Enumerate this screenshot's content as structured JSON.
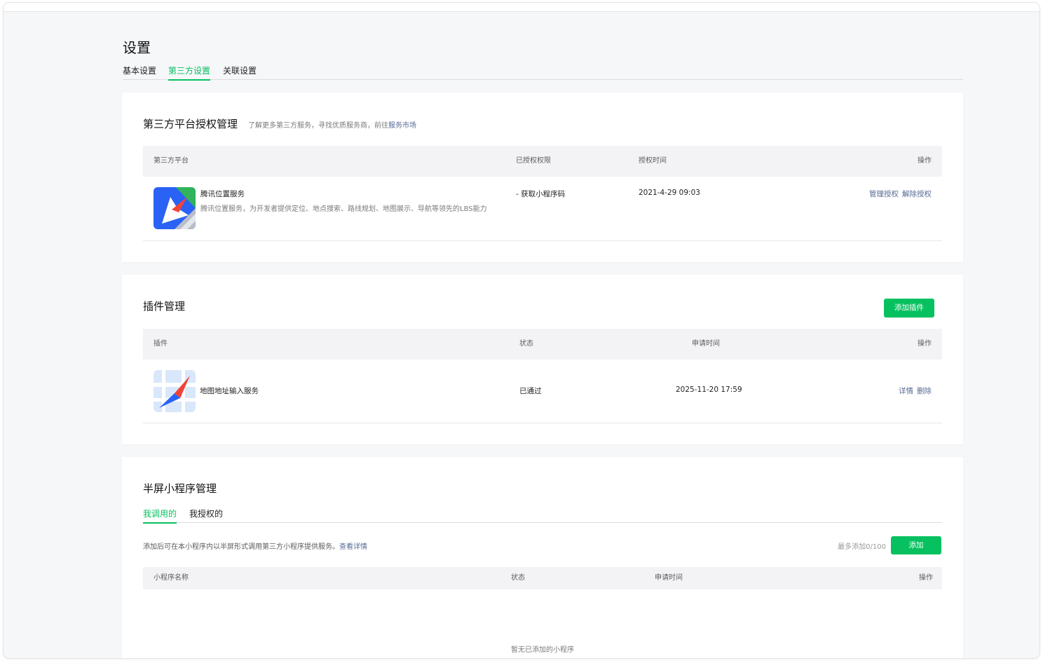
{
  "page": {
    "title": "设置"
  },
  "tabs": [
    {
      "label": "基本设置",
      "active": false
    },
    {
      "label": "第三方设置",
      "active": true
    },
    {
      "label": "关联设置",
      "active": false
    }
  ],
  "third_party": {
    "title": "第三方平台授权管理",
    "desc_prefix": "了解更多第三方服务，寻找优质服务商，前往",
    "desc_link": "服务市场",
    "columns": [
      "第三方平台",
      "已授权权限",
      "授权时间",
      "操作"
    ],
    "rows": [
      {
        "name": "腾讯位置服务",
        "description": "腾讯位置服务，为开发者提供定位、地点搜索、路线规划、地图展示、导航等领先的LBS能力",
        "permissions": "- 获取小程序码",
        "time": "2021-4-29 09:03",
        "actions": [
          "管理授权",
          "解除授权"
        ],
        "icon": "tencent-map-compass-icon"
      }
    ]
  },
  "plugins": {
    "title": "插件管理",
    "add_button": "添加插件",
    "columns": [
      "插件",
      "状态",
      "申请时间",
      "操作"
    ],
    "rows": [
      {
        "name": "地图地址输入服务",
        "status": "已通过",
        "time": "2025-11-20 17:59",
        "actions": [
          "详情",
          "删除"
        ],
        "icon": "map-address-compass-icon"
      }
    ]
  },
  "half_screen": {
    "title": "半屏小程序管理",
    "tabs": [
      {
        "label": "我调用的",
        "active": true
      },
      {
        "label": "我授权的",
        "active": false
      }
    ],
    "hint_prefix": "添加后可在本小程序内以半屏形式调用第三方小程序提供服务。",
    "hint_link": "查看详情",
    "quota": "最多添加0/100",
    "add_button": "添加",
    "columns": [
      "小程序名称",
      "状态",
      "申请时间",
      "操作"
    ],
    "empty_text": "暂无已添加的小程序"
  },
  "colors": {
    "accent": "#07c160",
    "link": "#576b95",
    "table_header_bg": "#f3f3f5",
    "page_bg": "#f6f7f9"
  }
}
